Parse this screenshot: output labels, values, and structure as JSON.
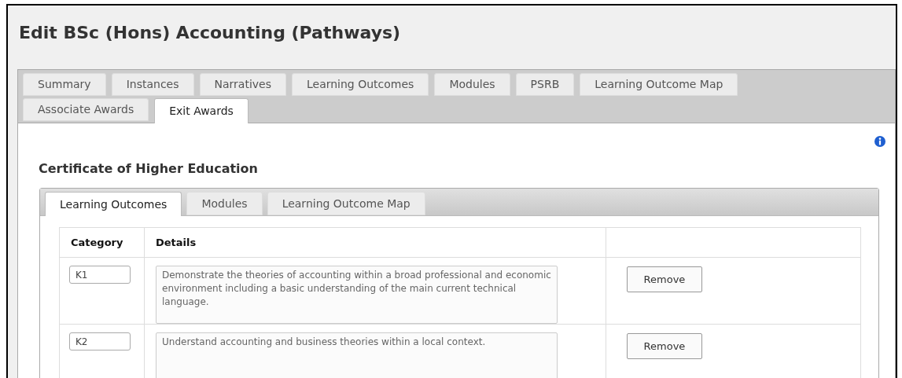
{
  "title": "Edit BSc (Hons) Accounting (Pathways)",
  "tabs": [
    {
      "label": "Summary",
      "selected": false
    },
    {
      "label": "Instances",
      "selected": false
    },
    {
      "label": "Narratives",
      "selected": false
    },
    {
      "label": "Learning Outcomes",
      "selected": false
    },
    {
      "label": "Modules",
      "selected": false
    },
    {
      "label": "PSRB",
      "selected": false
    },
    {
      "label": "Learning Outcome Map",
      "selected": false
    },
    {
      "label": "Associate Awards",
      "selected": false
    },
    {
      "label": "Exit Awards",
      "selected": true
    }
  ],
  "section_heading": "Certificate of Higher Education",
  "inner_tabs": [
    {
      "label": "Learning Outcomes",
      "selected": true
    },
    {
      "label": "Modules",
      "selected": false
    },
    {
      "label": "Learning Outcome Map",
      "selected": false
    }
  ],
  "table": {
    "columns": [
      "Category",
      "Details"
    ],
    "rows": [
      {
        "category": "K1",
        "details": "Demonstrate the theories of accounting within a broad professional and economic environment including a basic understanding of the main current technical language.",
        "action": "Remove"
      },
      {
        "category": "K2",
        "details": "Understand accounting and business theories within a local context.",
        "action": "Remove"
      }
    ]
  }
}
